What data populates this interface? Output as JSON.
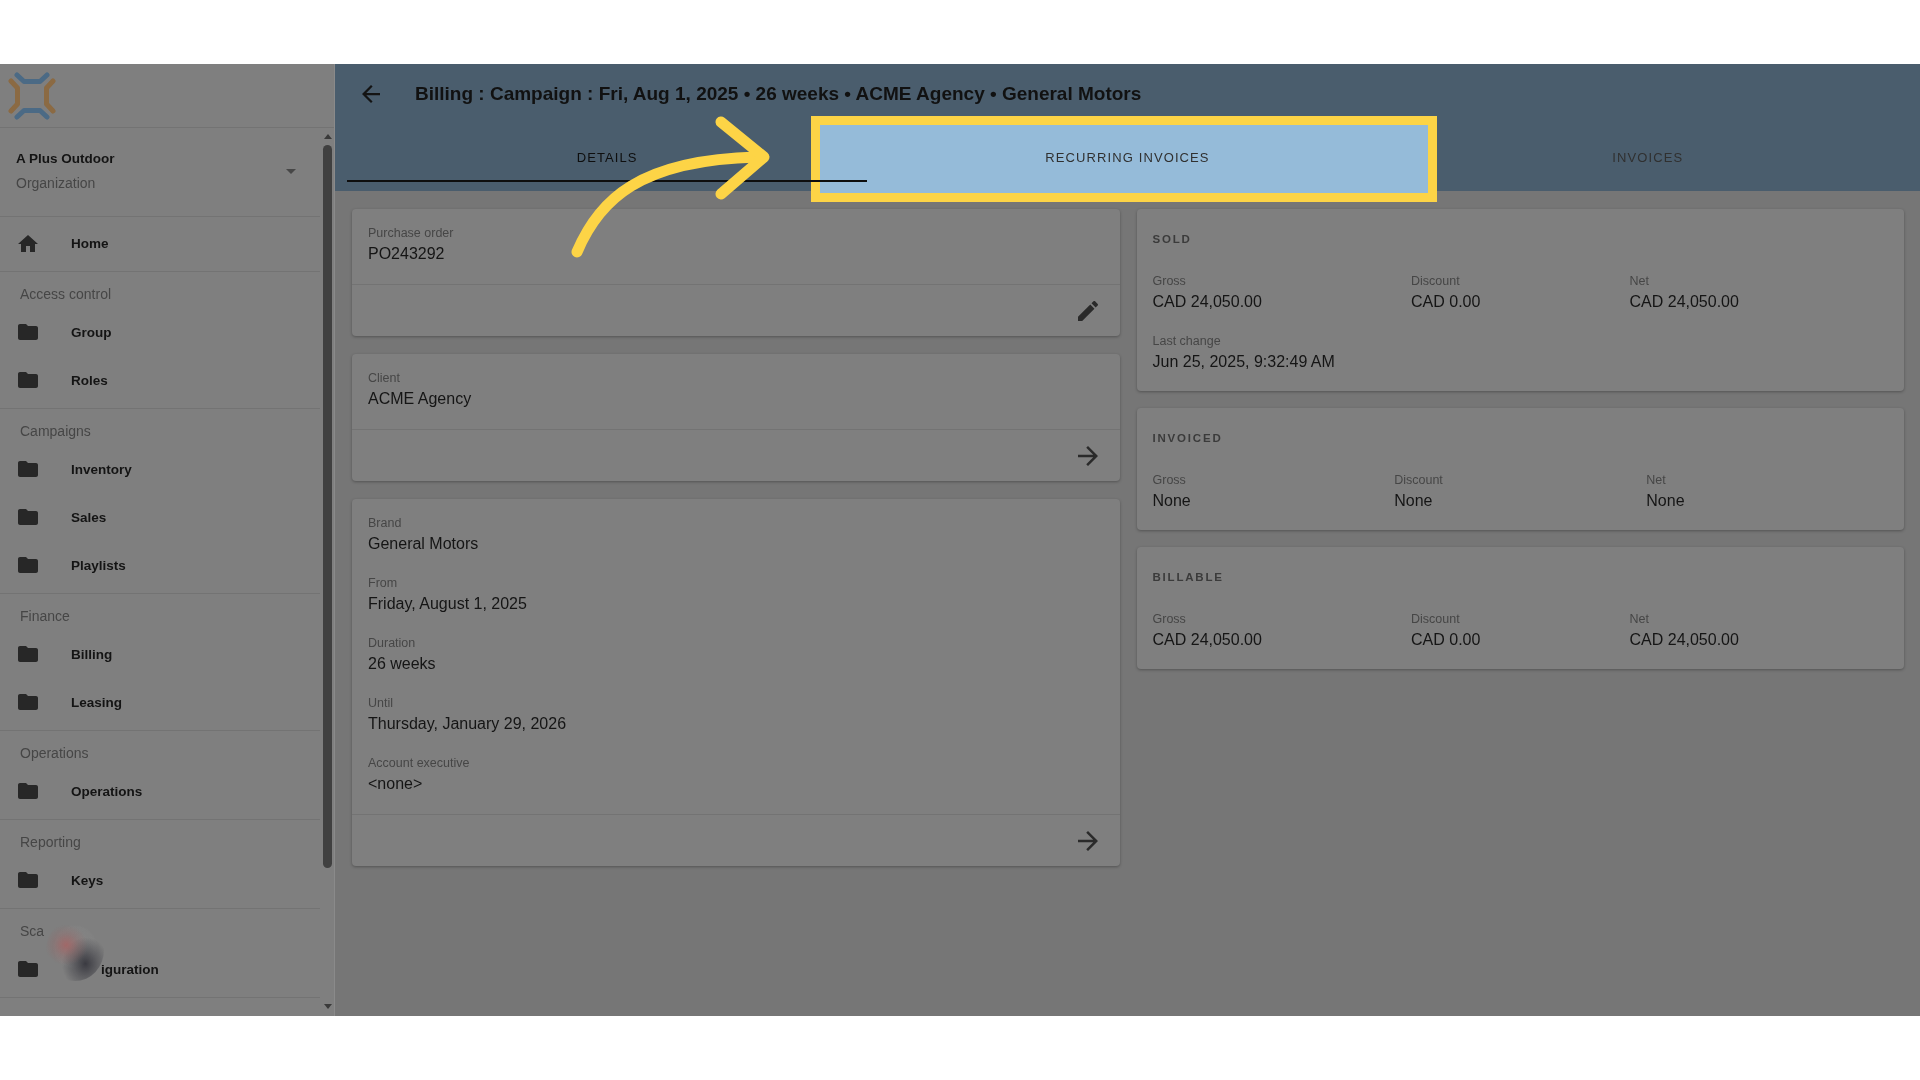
{
  "sidebar": {
    "organization": {
      "name": "A Plus Outdoor",
      "caption": "Organization"
    },
    "home": {
      "label": "Home"
    },
    "sections": [
      {
        "title": "Access control",
        "obscured": false,
        "items": [
          {
            "label": "Group"
          },
          {
            "label": "Roles"
          }
        ]
      },
      {
        "title": "Campaigns",
        "obscured": false,
        "items": [
          {
            "label": "Inventory"
          },
          {
            "label": "Sales"
          },
          {
            "label": "Playlists"
          }
        ]
      },
      {
        "title": "Finance",
        "obscured": false,
        "items": [
          {
            "label": "Billing"
          },
          {
            "label": "Leasing"
          }
        ]
      },
      {
        "title": "Operations",
        "obscured": false,
        "items": [
          {
            "label": "Operations"
          }
        ]
      },
      {
        "title": "Reporting",
        "obscured": false,
        "items": [
          {
            "label": "Keys"
          }
        ]
      },
      {
        "title": "Sca",
        "obscured": true,
        "items": [
          {
            "label": "iguration"
          }
        ]
      }
    ]
  },
  "header": {
    "title": "Billing : Campaign : Fri, Aug 1, 2025 • 26 weeks • ACME Agency • General Motors"
  },
  "tabs": [
    {
      "label": "DETAILS",
      "selected": true,
      "highlighted": false
    },
    {
      "label": "RECURRING INVOICES",
      "selected": false,
      "highlighted": true
    },
    {
      "label": "INVOICES",
      "selected": false,
      "highlighted": false
    }
  ],
  "detail_cards": [
    {
      "kind": "edit",
      "fields": [
        {
          "label": "Purchase order",
          "value": "PO243292"
        }
      ]
    },
    {
      "kind": "open",
      "fields": [
        {
          "label": "Client",
          "value": "ACME Agency"
        }
      ]
    },
    {
      "kind": "open",
      "fields": [
        {
          "label": "Brand",
          "value": "General Motors"
        },
        {
          "label": "From",
          "value": "Friday, August 1, 2025"
        },
        {
          "label": "Duration",
          "value": "26 weeks"
        },
        {
          "label": "Until",
          "value": "Thursday, January 29, 2026"
        },
        {
          "label": "Account executive",
          "value": "<none>"
        }
      ]
    }
  ],
  "summary_cards": [
    {
      "title": "SOLD",
      "rows": [
        {
          "fields": [
            {
              "label": "Gross",
              "value": "CAD 24,050.00"
            },
            {
              "label": "Discount",
              "value": "CAD 0.00"
            },
            {
              "label": "Net",
              "value": "CAD 24,050.00"
            }
          ]
        },
        {
          "fields": [
            {
              "label": "Last change",
              "value": "Jun 25, 2025, 9:32:49 AM"
            }
          ]
        }
      ]
    },
    {
      "title": "INVOICED",
      "rows": [
        {
          "fields": [
            {
              "label": "Gross",
              "value": "None"
            },
            {
              "label": "Discount",
              "value": "None"
            },
            {
              "label": "Net",
              "value": "None"
            }
          ]
        }
      ]
    },
    {
      "title": "BILLABLE",
      "rows": [
        {
          "fields": [
            {
              "label": "Gross",
              "value": "CAD 24,050.00"
            },
            {
              "label": "Discount",
              "value": "CAD 0.00"
            },
            {
              "label": "Net",
              "value": "CAD 24,050.00"
            }
          ]
        }
      ]
    }
  ]
}
